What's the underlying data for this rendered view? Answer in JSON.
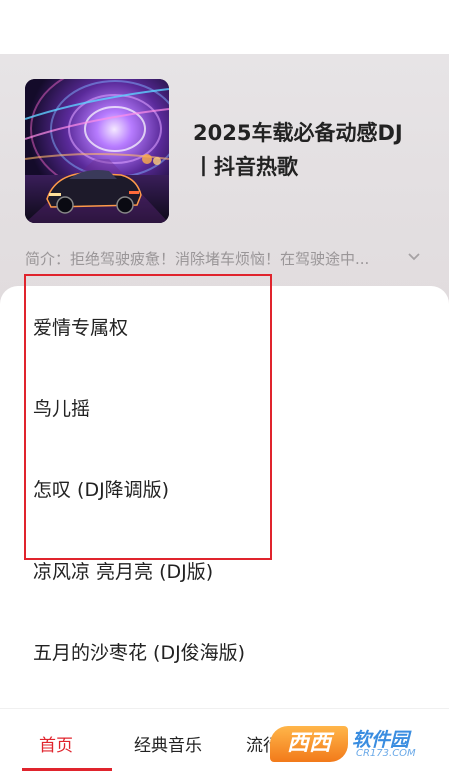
{
  "playlist": {
    "title_line1": "2025车载必备动感DJ",
    "title_line2": "丨抖音热歌",
    "intro": "简介：拒绝驾驶疲惫！消除堵车烦恼！在驾驶途中...",
    "expand_icon": "chevron-down-icon"
  },
  "songs": [
    "爱情专属权",
    "鸟儿摇",
    "怎叹 (DJ降调版)",
    "凉风凉 亮月亮 (DJ版)",
    "五月的沙枣花 (DJ俊海版)"
  ],
  "tabs": [
    {
      "label": "首页",
      "active": true
    },
    {
      "label": "经典音乐",
      "active": false
    },
    {
      "label": "流行音",
      "active": false
    }
  ],
  "watermark": {
    "logo_text": "西西",
    "name": "软件园",
    "url": "CR173.COM"
  },
  "colors": {
    "accent": "#e0242d",
    "header_bg": "#e4e0e2",
    "intro_text": "#9a9698"
  }
}
